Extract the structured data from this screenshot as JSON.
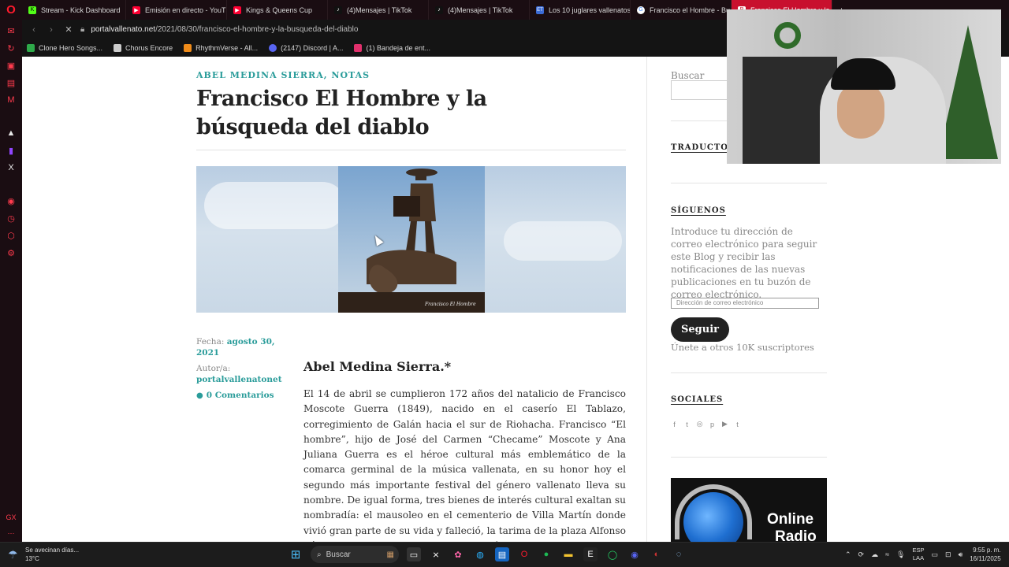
{
  "browser": {
    "tabs": [
      {
        "label": "Stream - Kick Dashboard",
        "color": "#53fc18",
        "glyph": "K"
      },
      {
        "label": "Emisión en directo - YouT",
        "color": "#ff0033",
        "glyph": "▶"
      },
      {
        "label": "Kings & Queens Cup",
        "color": "#ff0033",
        "glyph": "▶"
      },
      {
        "label": "(4)Mensajes | TikTok",
        "color": "#111111",
        "glyph": "♪"
      },
      {
        "label": "(4)Mensajes | TikTok",
        "color": "#111111",
        "glyph": "♪"
      },
      {
        "label": "Los 10 juglares vallenatos",
        "color": "#3b6bd6",
        "glyph": "ET"
      },
      {
        "label": "Francisco el Hombre - Bu",
        "color": "#4285f4",
        "glyph": "G"
      },
      {
        "label": "Francisco El Hombre y la",
        "color": "#ffffff",
        "glyph": "P"
      }
    ],
    "new_tab": "+",
    "url_host": "portalvallenato.net",
    "url_path": "/2021/08/30/francisco-el-hombre-y-la-busqueda-del-diablo",
    "bookmarks": [
      {
        "label": "Clone Hero Songs...",
        "color": "#2eaa4a"
      },
      {
        "label": "Chorus Encore",
        "color": "#cccccc"
      },
      {
        "label": "RhythmVerse - All...",
        "color": "#f08c1a"
      },
      {
        "label": "(2147) Discord | A...",
        "color": "#5865f2"
      },
      {
        "label": "(1) Bandeja de ent...",
        "color": "#e1306c"
      }
    ]
  },
  "article": {
    "categories": "ABEL MEDINA SIERRA, NOTAS",
    "title": "Francisco El Hombre y la búsqueda del diablo",
    "image_caption": "Francisco El Hombre",
    "date_label": "Fecha:",
    "date": "agosto 30, 2021",
    "author_label": "Autor/a:",
    "author": "portalvallenatonet",
    "comments": "0 Comentarios",
    "byline": "Abel Medina Sierra.*",
    "body": "El 14 de abril se cumplieron 172 años del natalicio de Francisco Moscote Guerra (1849), nacido en el caserío El Tablazo, corregimiento de Galán hacia el sur de Riohacha. Francisco “El hombre”, hijo de José del Carmen “Checame” Moscote y Ana Juliana Guerra es el héroe cultural más emblemático de la comarca germinal de la música vallenata, en su honor hoy el segundo más importante festival del género vallenato lleva su nombre. De igual forma, tres bienes de interés cultural exaltan su nombradía: el mausoleo en el cementerio de Villa Martín donde vivió gran parte de su vida y falleció, la tarima de la plaza Alfonso López donde se han coronado la mayoría de reyes"
  },
  "sidebar": {
    "search_label": "Buscar",
    "translator_title": "TRADUCTOR",
    "follow_title": "SÍGUENOS",
    "follow_desc": "Introduce tu dirección de correo electrónico para seguir este Blog y recibir las notificaciones de las nuevas publicaciones en tu buzón de correo electrónico.",
    "email_placeholder": "Dirección de correo electrónico",
    "follow_button": "Seguir",
    "subscribers": "Únete a otros 10K suscriptores",
    "social_title": "SOCIALES",
    "radio_line1": "Online",
    "radio_line2": "Radio"
  },
  "taskbar": {
    "weather_text": "Se avecinan días...",
    "temperature": "13°C",
    "search_placeholder": "Buscar",
    "lang_top": "ESP",
    "lang_bottom": "LAA",
    "time": "9:55 p. m.",
    "date": "16/11/2025"
  }
}
